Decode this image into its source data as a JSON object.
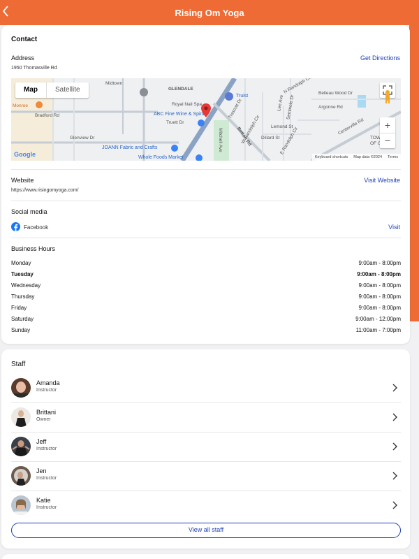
{
  "header": {
    "title": "Rising Om Yoga"
  },
  "contact": {
    "heading": "Contact",
    "address_label": "Address",
    "address": "1950 Thomasville Rd",
    "directions_link": "Get Directions",
    "map": {
      "map_tab": "Map",
      "satellite_tab": "Satellite",
      "labels": [
        "Midtown",
        "GLENDALE",
        "Royal Nail Spa",
        "Truist",
        "ABC Fine Wine & Spirits",
        "Truett Dr",
        "Bradford Rd",
        "Monroe",
        "Glenview Dr",
        "JOANN Fabric and Crafts",
        "Whole Foods Market",
        "Betton Rd",
        "Mitchell Ave",
        "Centerville Rd",
        "Belleau Wood Dr",
        "Argonne Rd",
        "Lemond St",
        "Dillard St",
        "E Randolph Cir",
        "W Randolph Cir",
        "Trescott Dr",
        "Lee Ave",
        "Seminole Dr",
        "N Randolph Cir",
        "TOWN OF ONE"
      ],
      "google": "Google",
      "attribution": [
        "Keyboard shortcuts",
        "Map data ©2024",
        "Terms"
      ]
    },
    "website_label": "Website",
    "website": "https://www.risingomyoga.com/",
    "website_link": "Visit Website",
    "social_label": "Social media",
    "facebook": "Facebook",
    "social_link": "Visit",
    "hours_label": "Business Hours",
    "hours": [
      {
        "day": "Monday",
        "time": "9:00am - 8:00pm"
      },
      {
        "day": "Tuesday",
        "time": "9:00am - 8:00pm"
      },
      {
        "day": "Wednesday",
        "time": "9:00am - 8:00pm"
      },
      {
        "day": "Thursday",
        "time": "9:00am - 8:00pm"
      },
      {
        "day": "Friday",
        "time": "9:00am - 8:00pm"
      },
      {
        "day": "Saturday",
        "time": "9:00am - 12:00pm"
      },
      {
        "day": "Sunday",
        "time": "11:00am - 7:00pm"
      }
    ]
  },
  "staff": {
    "heading": "Staff",
    "members": [
      {
        "name": "Amanda",
        "role": "Instructor"
      },
      {
        "name": "Brittani",
        "role": "Owner"
      },
      {
        "name": "Jeff",
        "role": "Instructor"
      },
      {
        "name": "Jen",
        "role": "Instructor"
      },
      {
        "name": "Katie",
        "role": "Instructor"
      }
    ],
    "view_all": "View all staff"
  },
  "colors": {
    "brand": "#ef6b35",
    "link": "#1f3fb5",
    "facebook": "#1877f2",
    "pin": "#e53935"
  },
  "icons": [
    "back-arrow-icon",
    "facebook-icon",
    "chevron-right-icon",
    "map-pin-icon",
    "pegman-icon",
    "fullscreen-icon"
  ]
}
